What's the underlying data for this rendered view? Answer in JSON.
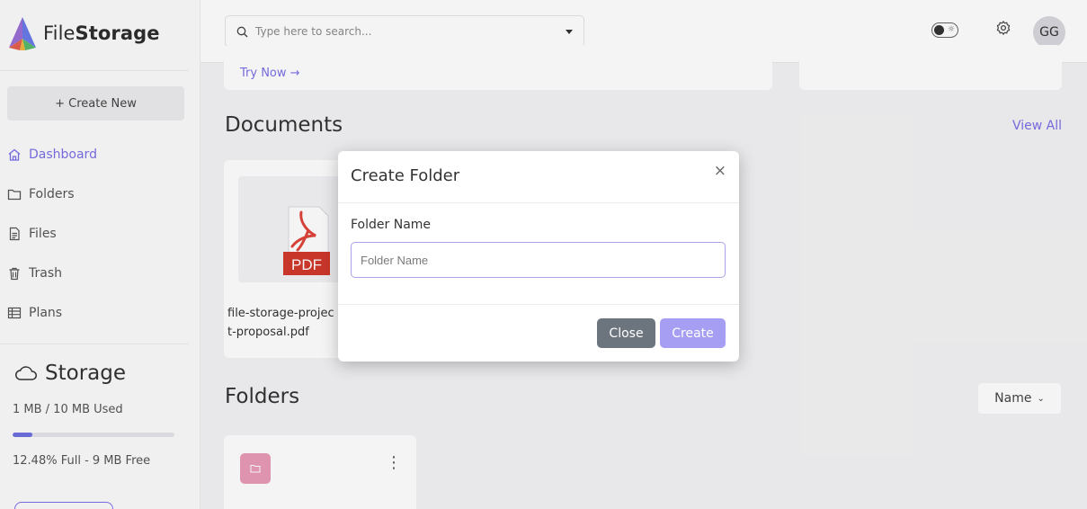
{
  "brand": {
    "name_light": "File",
    "name_bold": "Storage",
    "accent_color": "#7b6fe6"
  },
  "sidebar": {
    "create_new": {
      "icon": "plus-icon",
      "label": "+ Create New"
    },
    "items": [
      {
        "label": "Dashboard",
        "icon": "home-icon",
        "active": true
      },
      {
        "label": "Folders",
        "icon": "folder-icon",
        "active": false
      },
      {
        "label": "Files",
        "icon": "file-icon",
        "active": false
      },
      {
        "label": "Trash",
        "icon": "trash-icon",
        "active": false
      },
      {
        "label": "Plans",
        "icon": "plans-icon",
        "active": false
      }
    ],
    "storage": {
      "title": "Storage",
      "icon": "cloud-icon",
      "used_text": "1 MB / 10 MB Used",
      "percent_full": 12.48,
      "free_text": "12.48% Full - 9 MB Free"
    }
  },
  "header": {
    "search_placeholder": "Type here to search...",
    "avatar_initials": "GG",
    "theme_toggle": "sun-icon",
    "settings_icon": "gear-icon"
  },
  "main": {
    "promo_link": "Try Now →",
    "documents": {
      "title": "Documents",
      "view_all": "View All",
      "items": [
        {
          "thumb_label": "PDF",
          "name": "file-storage-project-proposal.pdf"
        }
      ]
    },
    "folders": {
      "title": "Folders",
      "sort_label": "Name"
    }
  },
  "modal": {
    "title": "Create Folder",
    "close_glyph": "×",
    "field_label": "Folder Name",
    "field_placeholder": "Folder Name",
    "field_value": "",
    "buttons": {
      "close": "Close",
      "create": "Create"
    }
  }
}
